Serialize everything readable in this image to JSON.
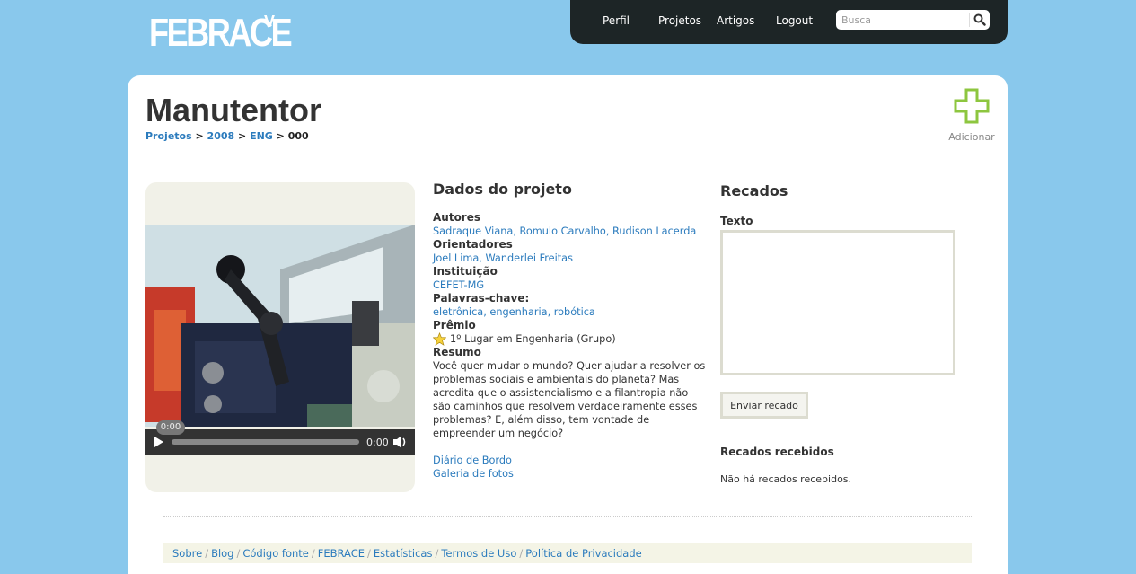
{
  "brand": {
    "logo": "FEBRACE",
    "logo_mark": "V"
  },
  "nav": {
    "items": [
      "Perfil",
      "Projetos",
      "Artigos",
      "Logout"
    ],
    "search_placeholder": "Busca"
  },
  "page": {
    "title": "Manutentor",
    "breadcrumb": [
      "Projetos",
      "2008",
      "ENG",
      "000"
    ],
    "breadcrumb_sep": ">",
    "add_label": "Adicionar"
  },
  "video": {
    "elapsed": "0:00",
    "time": "0:00",
    "progress": 0
  },
  "project": {
    "heading": "Dados do projeto",
    "authors_label": "Autores",
    "authors": "Sadraque Viana, Romulo Carvalho, Rudison Lacerda",
    "advisors_label": "Orientadores",
    "advisors": "Joel Lima, Wanderlei Freitas",
    "institution_label": "Instituição",
    "institution": "CEFET-MG",
    "keywords_label": "Palavras-chave:",
    "keywords": "eletrônica, engenharia, robótica",
    "award_label": "Prêmio",
    "award": "1º Lugar em Engenharia (Grupo)",
    "summary_label": "Resumo",
    "summary": "Você quer mudar o mundo? Quer ajudar a resolver os problemas sociais e ambientais do planeta? Mas acredita que o assistencialismo e a filantropia não são caminhos que resolvem verdadeiramente esses problemas? E, além disso, tem vontade de empreender um negócio?",
    "diary_link": "Diário de Bordo",
    "gallery_link": "Galeria de fotos"
  },
  "messages": {
    "heading": "Recados",
    "text_label": "Texto",
    "send_button": "Enviar recado",
    "received_heading": "Recados recebidos",
    "none_text": "Não há recados recebidos."
  },
  "footer": {
    "links": [
      "Sobre",
      "Blog",
      "Código fonte",
      "FEBRACE",
      "Estatísticas",
      "Termos de Uso",
      "Política de Privacidade"
    ],
    "sep": "/"
  },
  "colors": {
    "background": "#89c8ec",
    "topbar": "#1d2526",
    "link": "#2b7bbd",
    "add_icon": "#8dc63f"
  }
}
